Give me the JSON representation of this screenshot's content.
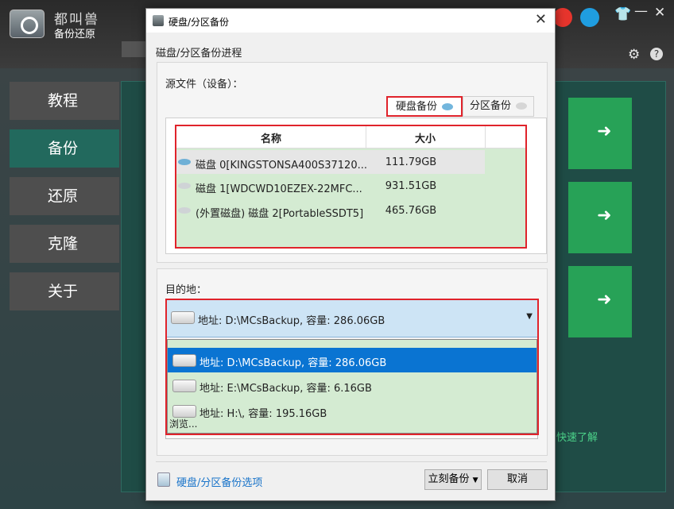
{
  "app": {
    "brand_top": "都叫兽",
    "brand_bottom": "备份还原",
    "sidebar": [
      {
        "label": "教程"
      },
      {
        "label": "备份"
      },
      {
        "label": "还原"
      },
      {
        "label": "克隆"
      },
      {
        "label": "关于"
      }
    ],
    "active_sidebar": "备份",
    "quick_link": "快速了解",
    "icons": [
      "weibo-icon",
      "qq-icon",
      "shirt-icon",
      "minimize-icon",
      "close-icon",
      "settings-icon",
      "help-icon"
    ]
  },
  "dialog": {
    "title": "硬盘/分区备份",
    "close": "✕",
    "progress_title": "磁盘/分区备份进程",
    "source_label": "源文件（设备）：",
    "tabs": {
      "disk": "硬盘备份",
      "partition": "分区备份"
    },
    "table": {
      "headers": {
        "name": "名称",
        "size": "大小"
      },
      "rows": [
        {
          "name": "磁盘 0[KINGSTONSA400S37120...",
          "size": "111.79GB"
        },
        {
          "name": "磁盘 1[WDCWD10EZEX-22MFC...",
          "size": "931.51GB"
        },
        {
          "name": "(外置磁盘) 磁盘 2[PortableSSDT5]",
          "size": "465.76GB"
        }
      ]
    },
    "dest_label": "目的地：",
    "dest_selected": "地址: D:\\MCsBackup, 容量: 286.06GB",
    "dest_options": [
      "地址: D:\\MCsBackup, 容量: 286.06GB",
      "地址: E:\\MCsBackup, 容量: 6.16GB",
      "地址: H:\\, 容量: 195.16GB"
    ],
    "browse": "浏览...",
    "options_link": "硬盘/分区备份选项",
    "backup_button": "立刻备份",
    "cancel_button": "取消"
  }
}
